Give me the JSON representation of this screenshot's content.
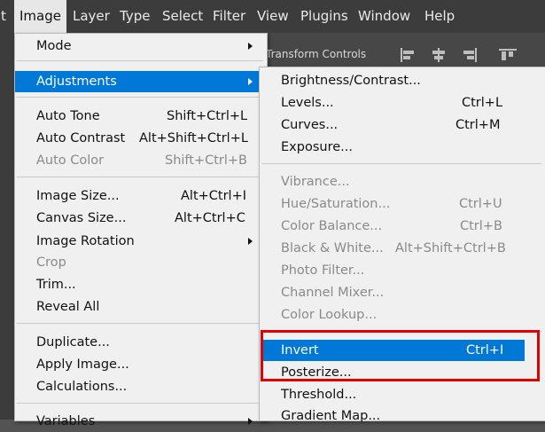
{
  "menubar": {
    "items": [
      "t",
      "Image",
      "Layer",
      "Type",
      "Select",
      "Filter",
      "View",
      "Plugins",
      "Window",
      "Help"
    ]
  },
  "toolbar": {
    "transform_controls": "Transform Controls"
  },
  "image_menu": {
    "items": [
      {
        "label": "Mode",
        "shortcut": "",
        "submenu": true,
        "disabled": false
      },
      {
        "label": "Adjustments",
        "shortcut": "",
        "submenu": true,
        "disabled": false,
        "selected": true
      },
      {
        "label": "Auto Tone",
        "shortcut": "Shift+Ctrl+L",
        "disabled": false
      },
      {
        "label": "Auto Contrast",
        "shortcut": "Alt+Shift+Ctrl+L",
        "disabled": false
      },
      {
        "label": "Auto Color",
        "shortcut": "Shift+Ctrl+B",
        "disabled": true
      },
      {
        "label": "Image Size...",
        "shortcut": "Alt+Ctrl+I",
        "disabled": false
      },
      {
        "label": "Canvas Size...",
        "shortcut": "Alt+Ctrl+C",
        "disabled": false
      },
      {
        "label": "Image Rotation",
        "shortcut": "",
        "submenu": true,
        "disabled": false
      },
      {
        "label": "Crop",
        "shortcut": "",
        "disabled": true
      },
      {
        "label": "Trim...",
        "shortcut": "",
        "disabled": false
      },
      {
        "label": "Reveal All",
        "shortcut": "",
        "disabled": false
      },
      {
        "label": "Duplicate...",
        "shortcut": "",
        "disabled": false
      },
      {
        "label": "Apply Image...",
        "shortcut": "",
        "disabled": false
      },
      {
        "label": "Calculations...",
        "shortcut": "",
        "disabled": false
      },
      {
        "label": "Variables",
        "shortcut": "",
        "submenu": true,
        "disabled": false
      }
    ]
  },
  "adjustments_menu": {
    "items": [
      {
        "label": "Brightness/Contrast...",
        "shortcut": "",
        "disabled": false
      },
      {
        "label": "Levels...",
        "shortcut": "Ctrl+L",
        "disabled": false
      },
      {
        "label": "Curves...",
        "shortcut": "Ctrl+M",
        "disabled": false
      },
      {
        "label": "Exposure...",
        "shortcut": "",
        "disabled": false
      },
      {
        "label": "Vibrance...",
        "shortcut": "",
        "disabled": true
      },
      {
        "label": "Hue/Saturation...",
        "shortcut": "Ctrl+U",
        "disabled": true
      },
      {
        "label": "Color Balance...",
        "shortcut": "Ctrl+B",
        "disabled": true
      },
      {
        "label": "Black & White...",
        "shortcut": "Alt+Shift+Ctrl+B",
        "disabled": true
      },
      {
        "label": "Photo Filter...",
        "shortcut": "",
        "disabled": true
      },
      {
        "label": "Channel Mixer...",
        "shortcut": "",
        "disabled": true
      },
      {
        "label": "Color Lookup...",
        "shortcut": "",
        "disabled": true
      },
      {
        "label": "Invert",
        "shortcut": "Ctrl+I",
        "disabled": false,
        "selected": true
      },
      {
        "label": "Posterize...",
        "shortcut": "",
        "disabled": false
      },
      {
        "label": "Threshold...",
        "shortcut": "",
        "disabled": false
      },
      {
        "label": "Gradient Map...",
        "shortcut": "",
        "disabled": false
      }
    ]
  },
  "colors": {
    "selection": "#0078d7",
    "highlight_box": "#e00000",
    "menu_bg": "#f0f0f0"
  }
}
